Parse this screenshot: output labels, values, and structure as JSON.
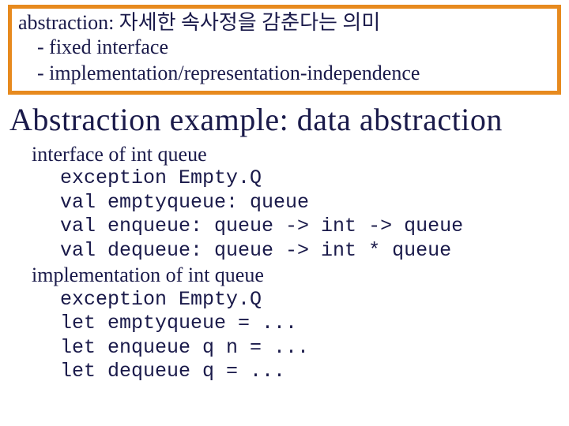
{
  "box": {
    "line1": "abstraction: 자세한 속사정을 감춘다는 의미",
    "bullet1": "- fixed interface",
    "bullet2": "- implementation/representation-independence"
  },
  "title": "Abstraction example: data abstraction",
  "interface": {
    "head": "interface of int queue",
    "l1": "exception Empty.Q",
    "l2": "val emptyqueue: queue",
    "l3": "val enqueue: queue -> int -> queue",
    "l4": "val dequeue: queue -> int * queue"
  },
  "impl": {
    "head": "implementation of int queue",
    "l1": "exception Empty.Q",
    "l2": "let emptyqueue = ...",
    "l3": "let enqueue q n = ...",
    "l4": "let dequeue q = ..."
  }
}
